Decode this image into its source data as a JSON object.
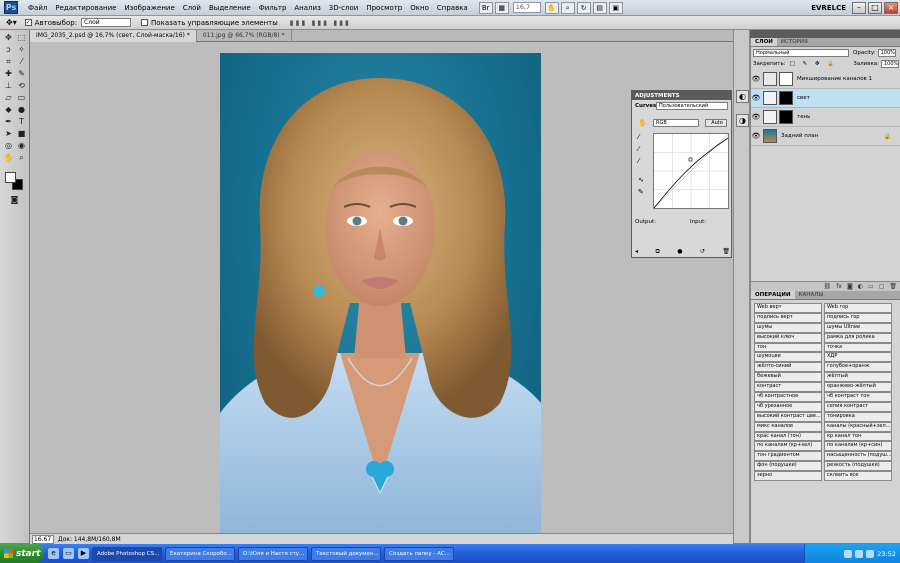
{
  "menubar": {
    "logo": "Ps",
    "items": [
      "Файл",
      "Редактирование",
      "Изображение",
      "Слой",
      "Выделение",
      "Фильтр",
      "Анализ",
      "3D-слои",
      "Просмотр",
      "Окно",
      "Справка"
    ],
    "zoom": "16,7",
    "workspace": "EVRELCE"
  },
  "optbar": {
    "autoselect_label": "Автовыбор:",
    "autoselect_value": "Слой",
    "show_controls_label": "Показать управляющие элементы"
  },
  "tabs": [
    {
      "label": "IMG_2035_2.psd @ 16,7% (свет, Слой-маска/16) *",
      "active": true
    },
    {
      "label": "011.jpg @ 66,7% (RGB/8) *",
      "active": false
    }
  ],
  "status": {
    "zoom": "16,67 %",
    "doc": "Док: 144,8M/160,8M"
  },
  "adjustments": {
    "title": "ADJUSTMENTS",
    "curves_label": "Curves",
    "preset": "Пользовательский",
    "channel": "RGB",
    "auto": "Auto",
    "output": "Output:",
    "input": "Input:"
  },
  "layers_panel": {
    "tabs": [
      "СЛОИ",
      "ИСТОРИЯ"
    ],
    "blend_mode": "Нормальный",
    "opacity_label": "Opacity:",
    "opacity": "100%",
    "lock_label": "Закрепить:",
    "fill_label": "Заливка:",
    "fill": "100%",
    "layers": [
      {
        "name": "Микширование каналов 1",
        "selected": false
      },
      {
        "name": "свет",
        "selected": true
      },
      {
        "name": "тень",
        "selected": false
      },
      {
        "name": "Задний план",
        "selected": false
      }
    ]
  },
  "actions_panel": {
    "tabs": [
      "ОПЕРАЦИИ",
      "КАНАЛЫ"
    ],
    "items": [
      "Web верт",
      "Web гор",
      "подпись верт",
      "подпись гор",
      "шумы",
      "шумы Ultraw",
      "высокий ключ",
      "рамка для ролика",
      "тон",
      "точка",
      "шумоцве",
      "ХДР",
      "жёлто-синий",
      "голубое+оранж",
      "бежевый",
      "жёлтый",
      "контраст",
      "оранжево-жёлтый",
      "чб контрастное",
      "чб контраст тон",
      "чб урезанное",
      "сепия контраст",
      "высокий контраст цве...",
      "тонировка",
      "микс каналов",
      "каналы (красный+зел...",
      "крас канал (тон)",
      "кр канал тон",
      "по каналам (кр+зел)",
      "по каналам (кр+син)",
      "тон градиентом",
      "насыщенность (подуш...",
      "фон (подушки)",
      "резкость (подушки)",
      "зерно",
      "склеить все"
    ]
  },
  "taskbar": {
    "start": "start",
    "tasks": [
      {
        "label": "Adobe Photoshop CS...",
        "active": true
      },
      {
        "label": "Екатерина Скоробо...",
        "active": false
      },
      {
        "label": "D:\\Юля и Настя сту...",
        "active": false
      },
      {
        "label": "Текстовый докумен...",
        "active": false
      },
      {
        "label": "Создать папку - АС...",
        "active": false
      }
    ],
    "clock": "23:52"
  }
}
